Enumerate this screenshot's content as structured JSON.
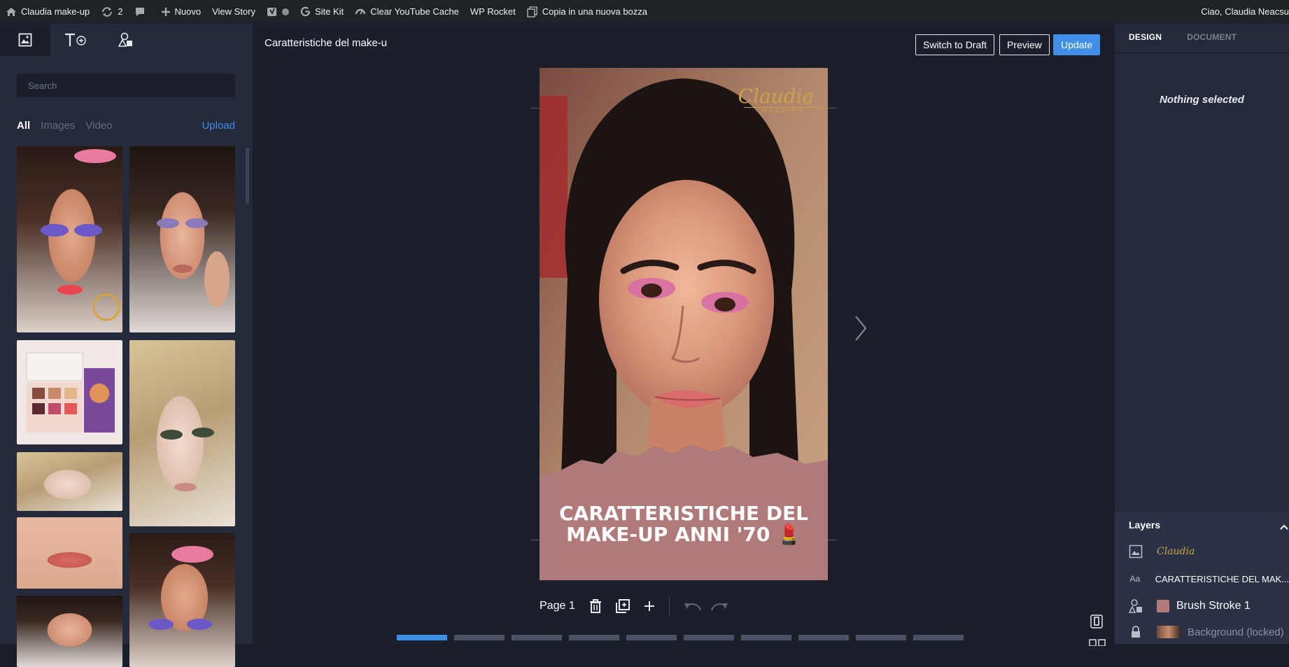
{
  "admin_bar": {
    "site_name": "Claudia make-up",
    "updates_count": "2",
    "new_label": "Nuovo",
    "view_story": "View Story",
    "site_kit": "Site Kit",
    "clear_cache": "Clear YouTube Cache",
    "wp_rocket": "WP Rocket",
    "copy_draft": "Copia in una nuova bozza",
    "greeting": "Ciao, Claudia Neacsu"
  },
  "library": {
    "search_placeholder": "Search",
    "filters": [
      "All",
      "Images",
      "Video"
    ],
    "active_filter": "All",
    "upload_label": "Upload"
  },
  "editor": {
    "story_title": "Caratteristiche del make-u",
    "switch_draft": "Switch to Draft",
    "preview": "Preview",
    "update": "Update",
    "page_label": "Page 1",
    "story_logo": "Claudia",
    "story_logo_sub": "MAKE-UP",
    "story_heading_line1": "CARATTERISTICHE DEL",
    "story_heading_line2": "MAKE-UP ANNI '70 💄",
    "page_dots_count": 10,
    "active_page_index": 0
  },
  "sidebar": {
    "tabs": [
      "DESIGN",
      "DOCUMENT"
    ],
    "active_tab": "DESIGN",
    "empty_state": "Nothing selected",
    "layers_title": "Layers",
    "layers": [
      {
        "name": "Claudia",
        "type": "image-icon"
      },
      {
        "name": "CARATTERISTICHE DEL MAK...",
        "type": "text-icon"
      },
      {
        "name": "Brush Stroke 1",
        "type": "shape-icon"
      },
      {
        "name": "Background (locked)",
        "type": "lock-icon"
      }
    ]
  },
  "colors": {
    "accent": "#3f8fe8",
    "panel": "#242a3b",
    "canvas": "#1b1f2b",
    "brush": "#b07a7a",
    "admin_bar": "#1d2327"
  }
}
